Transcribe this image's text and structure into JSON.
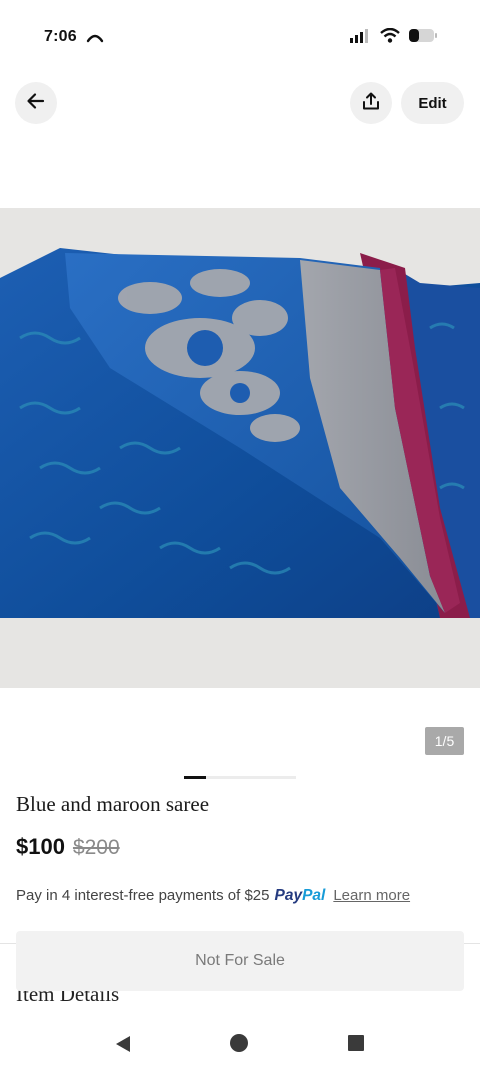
{
  "status_bar": {
    "time": "7:06",
    "icons": [
      "call-forwarding-icon",
      "signal-icon",
      "wifi-icon",
      "battery-icon"
    ]
  },
  "header": {
    "back_icon": "arrow-left-icon",
    "share_icon": "share-upload-icon",
    "edit_label": "Edit"
  },
  "gallery": {
    "image_description": "product-photo",
    "counter": "1/5",
    "progress_fraction": 0.2
  },
  "item": {
    "title": "Blue and maroon saree",
    "price": "$100",
    "original_price": "$200"
  },
  "payments": {
    "text": "Pay in 4 interest-free payments of $25",
    "paypal_pay": "Pay",
    "paypal_pal": "Pal",
    "learn_more": "Learn more",
    "paypal_colors": {
      "pay": "#253b80",
      "pal": "#179bd7"
    }
  },
  "section": {
    "item_details": "Item Details"
  },
  "cta": {
    "label": "Not For Sale"
  },
  "nav": {
    "icons": [
      "nav-back-icon",
      "nav-home-icon",
      "nav-recents-icon"
    ]
  }
}
